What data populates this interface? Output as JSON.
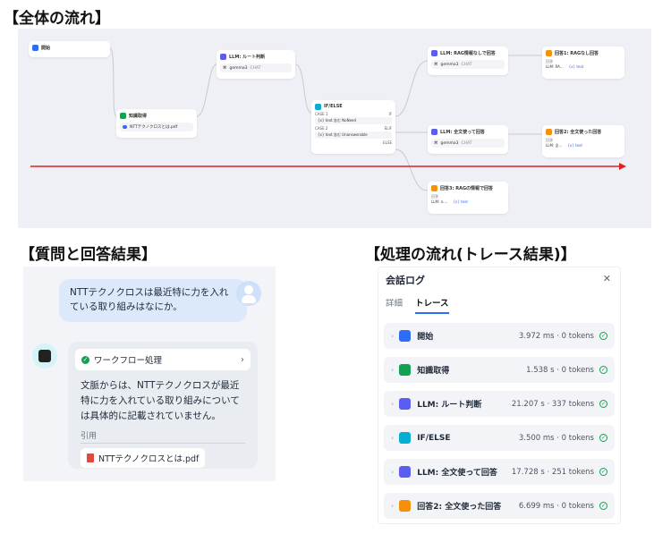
{
  "headings": {
    "overall": "【全体の流れ】",
    "qa": "【質問と回答結果】",
    "trace": "【処理の流れ(トレース結果)】"
  },
  "workflow": {
    "start": {
      "label": "開始"
    },
    "knowledge": {
      "label": "知識取得",
      "file": "NTTテクノクロスとは.pdf"
    },
    "route": {
      "label": "LLM: ルート判断",
      "model": "gemma3",
      "badge": "CHAT"
    },
    "ifelse": {
      "label": "IF/ELSE",
      "case1": "CASE 1",
      "case1_port": "IF",
      "case1_cond": "{x} text 含む NoNeed",
      "case2": "CASE 2",
      "case2_port": "ELIF",
      "case2_cond": "{x} text 含む Unanswerable",
      "else": "ELSE"
    },
    "llm_norag": {
      "label": "LLM: RAG情報なしで回答",
      "model": "gemma3",
      "badge": "CHAT"
    },
    "ans1": {
      "label": "回答1: RAGなし回答",
      "sub1": "回答",
      "sub2": "LLM: RA...",
      "sub3": "{x} text"
    },
    "llm_full": {
      "label": "LLM: 全文使って回答",
      "model": "gemma3",
      "badge": "CHAT"
    },
    "ans2": {
      "label": "回答2: 全文使った回答",
      "sub1": "回答",
      "sub2": "LLM: 全...",
      "sub3": "{x} text"
    },
    "ans3": {
      "label": "回答3: RAGの情報で回答",
      "sub1": "回答",
      "sub2": "LLM: ル...",
      "sub3": "{x} text"
    }
  },
  "chat": {
    "user_message": "NTTテクノクロスは最近特に力を入れている取り組みはなにか。",
    "workflow_label": "ワークフロー処理",
    "answer": "文脈からは、NTTテクノクロスが最近特に力を入れている取り組みについては具体的に記載されていません。",
    "citation_label": "引用",
    "citation_file": "NTTテクノクロスとは.pdf"
  },
  "trace": {
    "title": "会話ログ",
    "tabs": [
      "詳細",
      "トレース"
    ],
    "rows": [
      {
        "name": "開始",
        "metric": "3.972 ms · 0 tokens",
        "color": "#2f6cf6"
      },
      {
        "name": "知識取得",
        "metric": "1.538 s · 0 tokens",
        "color": "#12a150"
      },
      {
        "name": "LLM: ルート判断",
        "metric": "21.207 s · 337 tokens",
        "color": "#5b5cf0"
      },
      {
        "name": "IF/ELSE",
        "metric": "3.500 ms · 0 tokens",
        "color": "#06aed4"
      },
      {
        "name": "LLM: 全文使って回答",
        "metric": "17.728 s · 251 tokens",
        "color": "#5b5cf0"
      },
      {
        "name": "回答2: 全文使った回答",
        "metric": "6.699 ms · 0 tokens",
        "color": "#f79009"
      }
    ]
  }
}
